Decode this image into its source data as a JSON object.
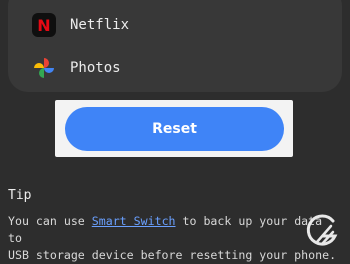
{
  "apps": [
    {
      "name": "Netflix",
      "icon": "netflix-icon",
      "glyph": "N"
    },
    {
      "name": "Photos",
      "icon": "google-photos-icon"
    }
  ],
  "reset": {
    "label": "Reset",
    "color": "#3f84f7"
  },
  "tip": {
    "heading": "Tip",
    "text_before": "You can use ",
    "link": "Smart Switch",
    "text_after": " to back up your data to\nUSB storage device before resetting your phone."
  },
  "watermark": {
    "icon": "g-logo-watermark"
  }
}
